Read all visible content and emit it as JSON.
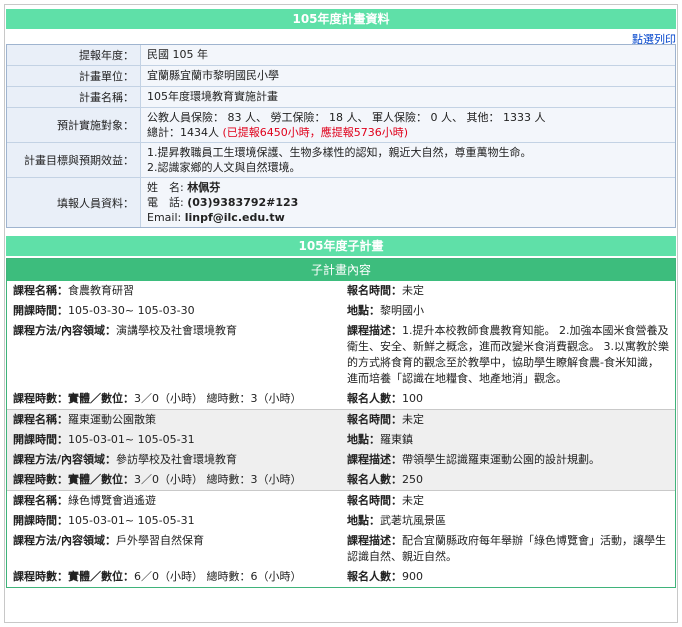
{
  "plan": {
    "title": "105年度計畫資料",
    "print_label": "點選列印",
    "rows": [
      {
        "label": "提報年度：",
        "value": "民國 105 年"
      },
      {
        "label": "計畫單位：",
        "value": "宜蘭縣宜蘭市黎明國民小學"
      },
      {
        "label": "計畫名稱：",
        "value": "105年度環境教育實施計畫"
      }
    ],
    "target": {
      "label": "預計實施對象：",
      "line1": "公教人員保險： 83 人、 勞工保險： 18 人、 軍人保險： 0 人、 其他： 1333 人",
      "total": "總計：1434人",
      "total_note": "(已提報6450小時，應提報5736小時)"
    },
    "goals": {
      "label": "計畫目標與預期效益：",
      "lines": [
        "1.提昇教職員工生環境保護、生物多樣性的認知，親近大自然，尊重萬物生命。",
        "2.認識家鄉的人文與自然環境。"
      ]
    },
    "contact": {
      "label": "填報人員資料：",
      "name_label": "姓　名:",
      "name": "林佩芬",
      "phone_label": "電　話:",
      "phone": "(03)9383792#123",
      "email_label": "Email:",
      "email": "linpf@ilc.edu.tw"
    }
  },
  "subplan": {
    "title": "105年度子計畫",
    "header": "子計畫內容",
    "labels": {
      "name": "課程名稱：",
      "signup": "報名時間：",
      "time": "開課時間：",
      "place": "地點：",
      "method": "課程方法/內容領域：",
      "desc": "課程描述：",
      "hours": "課程時數：實體／數位：",
      "people": "報名人數："
    },
    "courses": [
      {
        "name": "食農教育研習",
        "signup": "未定",
        "time": "105-03-30~ 105-03-30",
        "place": "黎明國小",
        "method": "演講學校及社會環境教育",
        "desc": "1.提升本校教師食農教育知能。 2.加強本國米食營養及衛生、安全、新鮮之概念，進而改變米食消費觀念。 3.以寓教於樂的方式將食育的觀念至於教學中，協助學生瞭解食農-食米知識，進而培養「認識在地糧食、地產地消」觀念。",
        "hours": "3／0（小時） 總時數：3（小時）",
        "people": "100"
      },
      {
        "name": "羅東運動公園散策",
        "signup": "未定",
        "time": "105-03-01~ 105-05-31",
        "place": "羅東鎮",
        "method": "參訪學校及社會環境教育",
        "desc": "帶領學生認識羅東運動公園的設計規劃。",
        "hours": "3／0（小時） 總時數：3（小時）",
        "people": "250"
      },
      {
        "name": "綠色博覽會逍遙遊",
        "signup": "未定",
        "time": "105-03-01~ 105-05-31",
        "place": "武荖坑風景區",
        "method": "戶外學習自然保育",
        "desc": "配合宜蘭縣政府每年舉辦「綠色博覽會」活動，讓學生認識自然、親近自然。",
        "hours": "6／0（小時） 總時數：6（小時）",
        "people": "900"
      }
    ]
  }
}
